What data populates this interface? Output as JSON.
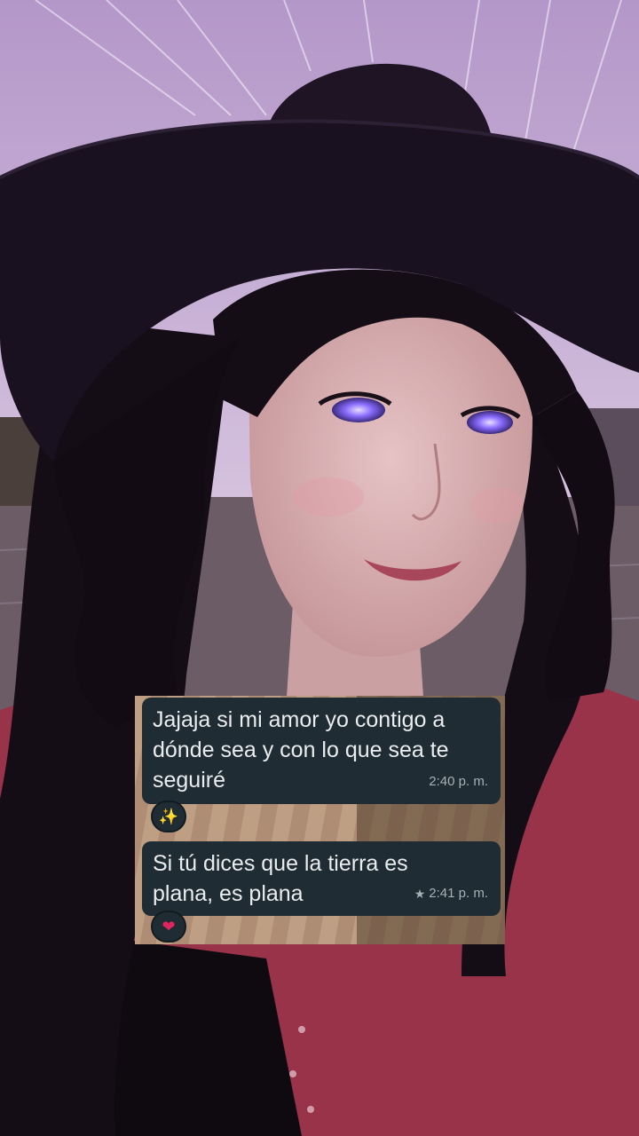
{
  "photo": {
    "description_icon": "portrait-photo",
    "colors": {
      "sky": "#c7a9d6",
      "hat": "#1e1424",
      "hair": "#140d16",
      "skin": "#d9b2b4",
      "jacket": "#a03a4e",
      "eyes": "#8b6bff"
    }
  },
  "chat": {
    "messages": [
      {
        "text": "Jajaja si mi amor yo contigo a\ndónde sea y con lo que sea te\nseguiré",
        "time": "2:40 p. m.",
        "starred": false,
        "reaction": "✨"
      },
      {
        "text": "Si tú dices que la tierra es\nplana, es plana",
        "time": "2:41 p. m.",
        "starred": true,
        "reaction": "❤"
      }
    ],
    "colors": {
      "bubble": "#202c33",
      "text": "#e9edef",
      "meta": "#a7b0b5"
    }
  }
}
